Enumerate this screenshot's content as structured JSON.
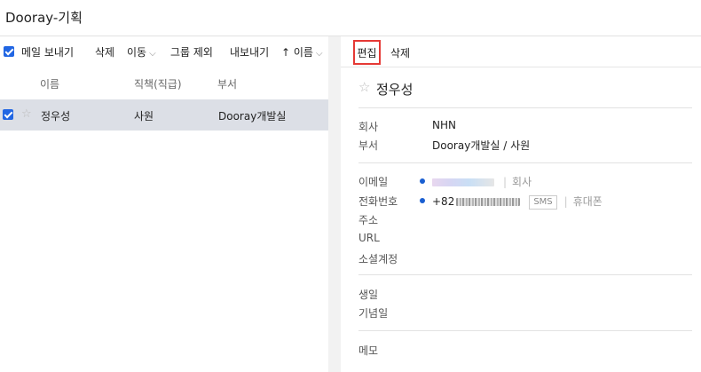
{
  "app": {
    "title": "Dooray-기획"
  },
  "toolbar": {
    "send_mail": "메일 보내기",
    "delete": "삭제",
    "move": "이동",
    "remove_group": "그룹 제외",
    "export": "내보내기",
    "sort_arrow": "↑",
    "sort": "이름"
  },
  "columns": {
    "name": "이름",
    "position": "직책(직급)",
    "department": "부서"
  },
  "rows": [
    {
      "name": "정우성",
      "position": "사원",
      "department": "Dooray개발실",
      "selected": true
    }
  ],
  "detail": {
    "edit": "편집",
    "delete": "삭제",
    "name": "정우성",
    "fields": {
      "company_label": "회사",
      "company": "NHN",
      "dept_label": "부서",
      "dept": "Dooray개발실 / 사원",
      "email_label": "이메일",
      "email_tag": "회사",
      "phone_label": "전화번호",
      "phone_prefix": "+82",
      "sms": "SMS",
      "phone_tag": "휴대폰",
      "address_label": "주소",
      "url_label": "URL",
      "social_label": "소셜계정",
      "birthday_label": "생일",
      "anniversary_label": "기념일",
      "memo_label": "메모"
    }
  },
  "colors": {
    "accent": "#2166e3",
    "selected_row": "#dcdfe6",
    "highlight_border": "#e53935",
    "dot": "#1a5fd1"
  },
  "icons": {
    "check": "checkbox-checked-icon",
    "star": "star-outline-icon",
    "caret": "chevron-down-icon",
    "sort": "arrow-up-icon"
  }
}
